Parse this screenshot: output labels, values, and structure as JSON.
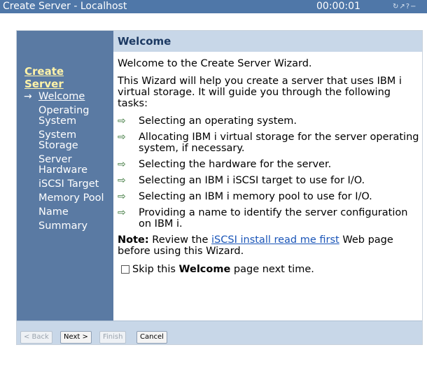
{
  "titlebar": {
    "title": "Create Server - Localhost",
    "timer": "00:00:01",
    "controls": "↻↗?−"
  },
  "sidebar": {
    "heading_line1": "Create",
    "heading_line2": "Server",
    "items": [
      {
        "label": "Welcome",
        "current": true
      },
      {
        "label": "Operating System",
        "current": false
      },
      {
        "label": "System Storage",
        "current": false
      },
      {
        "label": "Server Hardware",
        "current": false
      },
      {
        "label": "iSCSI Target",
        "current": false
      },
      {
        "label": "Memory Pool",
        "current": false
      },
      {
        "label": "Name",
        "current": false
      },
      {
        "label": "Summary",
        "current": false
      }
    ]
  },
  "main": {
    "header": "Welcome",
    "intro": "Welcome to the Create Server Wizard.",
    "description": "This Wizard will help you create a server that uses IBM i virtual storage. It will guide you through the following tasks:",
    "tasks": [
      "Selecting an operating system.",
      "Allocating IBM i virtual storage for the server operating system, if necessary.",
      "Selecting the hardware for the server.",
      "Selecting an IBM i iSCSI target to use for I/O.",
      "Selecting an IBM i memory pool to use for I/O.",
      "Providing a name to identify the server configuration on IBM i."
    ],
    "note_label": "Note:",
    "note_pre": "Review the",
    "note_link": "iSCSI install read me first",
    "note_post": "Web page before using this Wizard.",
    "skip_pre": "Skip this",
    "skip_bold": "Welcome",
    "skip_post": "page next time.",
    "skip_checked": false
  },
  "footer": {
    "back": "< Back",
    "next": "Next >",
    "finish": "Finish",
    "cancel": "Cancel"
  },
  "icons": {
    "current_step": "arrow-right-icon",
    "task_bullet": "outlined-arrow-right-icon"
  }
}
